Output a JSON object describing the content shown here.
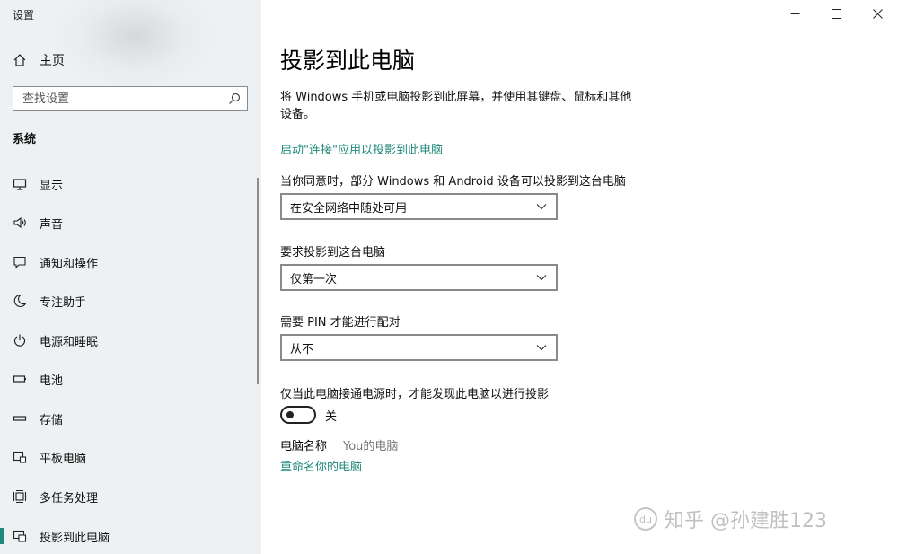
{
  "window": {
    "title": "设置"
  },
  "sidebar": {
    "home_label": "主页",
    "search_placeholder": "查找设置",
    "section_title": "系统",
    "items": [
      {
        "label": "显示",
        "icon": "monitor-icon"
      },
      {
        "label": "声音",
        "icon": "speaker-icon"
      },
      {
        "label": "通知和操作",
        "icon": "notification-icon"
      },
      {
        "label": "专注助手",
        "icon": "moon-icon"
      },
      {
        "label": "电源和睡眠",
        "icon": "power-icon"
      },
      {
        "label": "电池",
        "icon": "battery-icon"
      },
      {
        "label": "存储",
        "icon": "storage-icon"
      },
      {
        "label": "平板电脑",
        "icon": "tablet-icon"
      },
      {
        "label": "多任务处理",
        "icon": "multitask-icon"
      },
      {
        "label": "投影到此电脑",
        "icon": "project-icon",
        "active": true
      }
    ]
  },
  "main": {
    "title": "投影到此电脑",
    "description": "将 Windows 手机或电脑投影到此屏幕，并使用其键盘、鼠标和其他设备。",
    "launch_link": "启动\"连接\"应用以投影到此电脑",
    "availability": {
      "label": "当你同意时，部分 Windows 和 Android 设备可以投影到这台电脑",
      "value": "在安全网络中随处可用"
    },
    "ask_to_project": {
      "label": "要求投影到这台电脑",
      "value": "仅第一次"
    },
    "require_pin": {
      "label": "需要 PIN 才能进行配对",
      "value": "从不"
    },
    "power_discovery": {
      "label": "仅当此电脑接通电源时，才能发现此电脑以进行投影",
      "state": "关"
    },
    "pc_name": {
      "label": "电脑名称",
      "value": "You的电脑",
      "rename_link": "重命名你的电脑"
    }
  },
  "watermark": {
    "text": "知乎 @孙建胜123"
  },
  "colors": {
    "accent": "#1f8a7a",
    "sidebar_bg": "#eef1f3"
  }
}
